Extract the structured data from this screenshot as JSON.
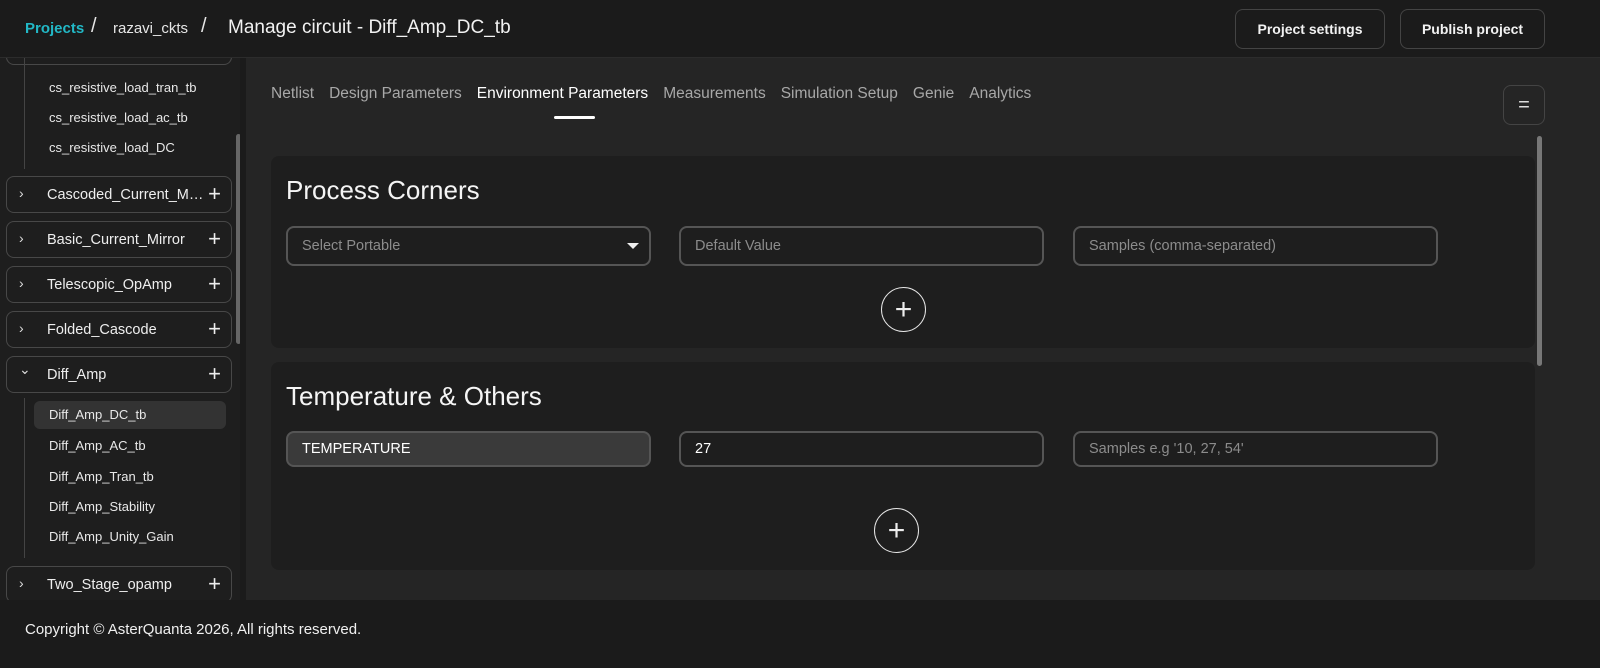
{
  "breadcrumb": {
    "projects": "Projects",
    "separator": "/",
    "namespace": "razavi_ckts",
    "title": "Manage circuit - Diff_Amp_DC_tb"
  },
  "header_buttons": {
    "settings": "Project settings",
    "publish": "Publish project"
  },
  "sidebar": {
    "top_items": [
      "cs_resistive_load_tran_tb",
      "cs_resistive_load_ac_tb",
      "cs_resistive_load_DC"
    ],
    "groups": [
      {
        "label": "Cascoded_Current_Mirror",
        "expanded": false
      },
      {
        "label": "Basic_Current_Mirror",
        "expanded": false
      },
      {
        "label": "Telescopic_OpAmp",
        "expanded": false
      },
      {
        "label": "Folded_Cascode",
        "expanded": false
      },
      {
        "label": "Diff_Amp",
        "expanded": true
      },
      {
        "label": "Two_Stage_opamp",
        "expanded": false
      }
    ],
    "diff_amp_items": [
      "Diff_Amp_DC_tb",
      "Diff_Amp_AC_tb",
      "Diff_Amp_Tran_tb",
      "Diff_Amp_Stability",
      "Diff_Amp_Unity_Gain"
    ],
    "active_item": "Diff_Amp_DC_tb",
    "icons": {
      "chevron_right": "›",
      "chevron_down": "⌄",
      "plus": "+"
    }
  },
  "tabs": [
    "Netlist",
    "Design Parameters",
    "Environment Parameters",
    "Measurements",
    "Simulation Setup",
    "Genie",
    "Analytics"
  ],
  "active_tab": "Environment Parameters",
  "process_corners": {
    "title": "Process Corners",
    "select_placeholder": "Select Portable",
    "default_placeholder": "Default Value",
    "samples_placeholder": "Samples (comma-separated)"
  },
  "temperature": {
    "title": "Temperature & Others",
    "name_value": "TEMPERATURE",
    "default_value": "27",
    "samples_placeholder": "Samples e.g '10, 27, 54'"
  },
  "footer": {
    "copyright": "Copyright © AsterQuanta 2026, All rights reserved."
  },
  "colors": {
    "accent": "#22b8c6",
    "background": "#1b1b1b",
    "card": "#1e1e1e"
  }
}
